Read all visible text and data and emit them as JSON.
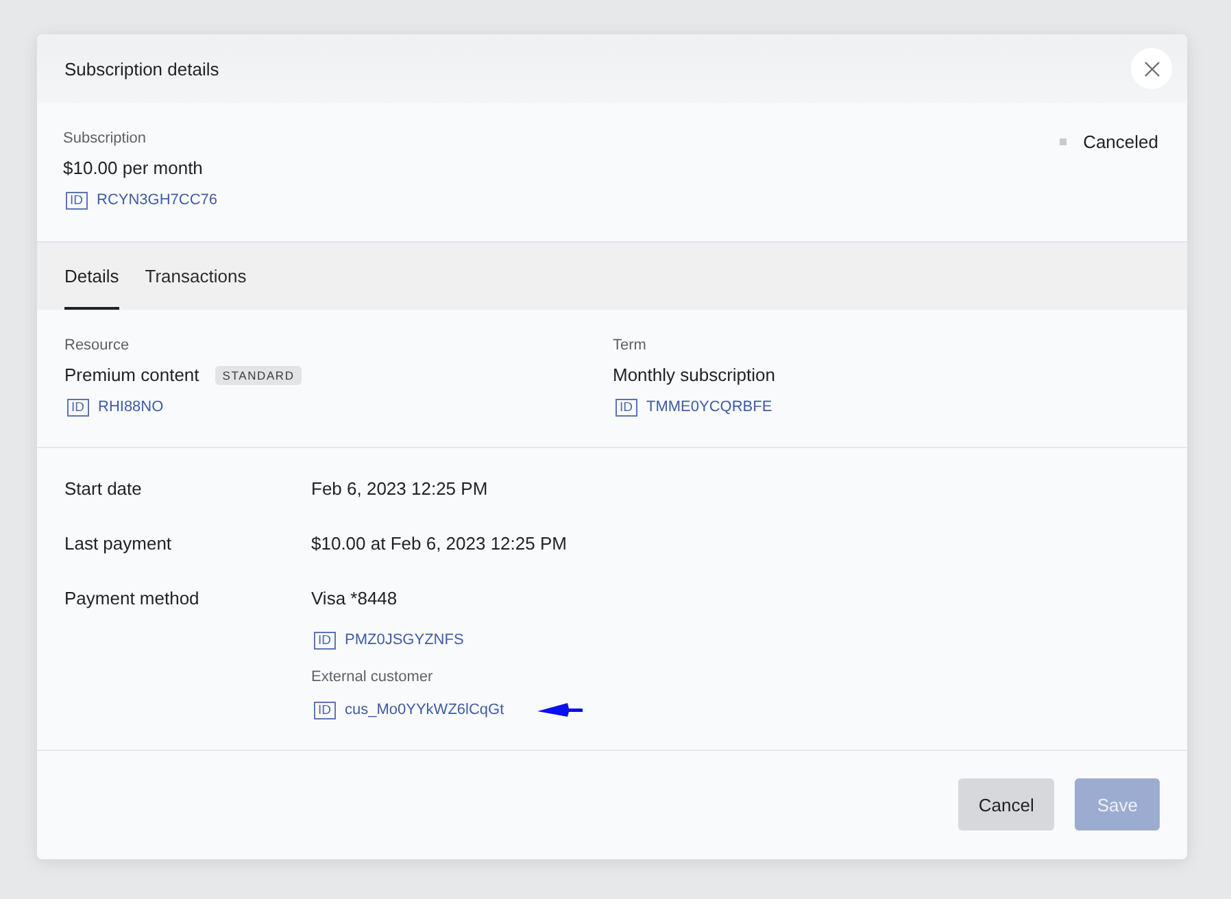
{
  "dialog": {
    "title": "Subscription details"
  },
  "subscription": {
    "label": "Subscription",
    "price": "$10.00 per month",
    "id": {
      "tag": "ID",
      "value": "RCYN3GH7CC76"
    },
    "status": "Canceled"
  },
  "tabs": [
    {
      "label": "Details",
      "selected": true
    },
    {
      "label": "Transactions",
      "selected": false
    }
  ],
  "summary": [
    {
      "label": "Resource",
      "value": "Premium content",
      "badge": "STANDARD",
      "id": {
        "tag": "ID",
        "value": "RHI88NO"
      }
    },
    {
      "label": "Term",
      "value": "Monthly subscription",
      "id": {
        "tag": "ID",
        "value": "TMME0YCQRBFE"
      }
    }
  ],
  "fields": [
    {
      "label": "Start date",
      "value": "Feb 6, 2023 12:25 PM"
    },
    {
      "label": "Last payment",
      "value": "$10.00 at Feb 6, 2023 12:25 PM"
    },
    {
      "label": "Payment method",
      "value": "Visa *8448",
      "id": {
        "tag": "ID",
        "value": "PMZ0JSGYZNFS"
      },
      "extra": {
        "label": "External customer",
        "id": {
          "tag": "ID",
          "value": "cus_Mo0YYkWZ6lCqGt"
        }
      }
    }
  ],
  "buttons": [
    {
      "label": "Cancel",
      "kind": "secondary",
      "disabled": false
    },
    {
      "label": "Save",
      "kind": "primary",
      "disabled": true
    }
  ]
}
